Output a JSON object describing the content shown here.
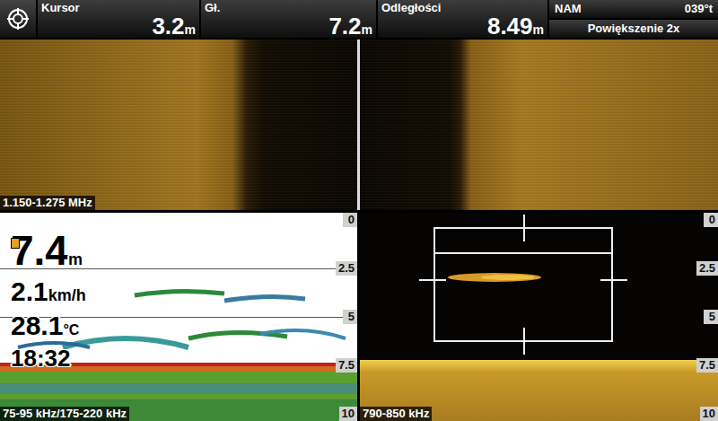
{
  "top_bar": {
    "fields": [
      {
        "label": "Kursor",
        "value": "3.2",
        "unit": "m"
      },
      {
        "label": "Gł.",
        "value": "7.2",
        "unit": "m"
      },
      {
        "label": "Odległości",
        "value": "8.49",
        "unit": "m"
      }
    ],
    "heading": {
      "label": "NAM",
      "value": "039°t"
    },
    "zoom": "Powiększenie 2x"
  },
  "side_imaging": {
    "frequency": "1.150-1.275 MHz"
  },
  "sonar_2d": {
    "readings": {
      "depth": {
        "value": "7.4",
        "unit": "m"
      },
      "speed": {
        "value": "2.1",
        "unit": "km/h"
      },
      "temperature": {
        "value": "28.1",
        "unit": "°C"
      },
      "time": "18:32"
    },
    "scale": [
      "0",
      "2.5",
      "5",
      "7.5",
      "10"
    ],
    "frequency": "75-95 kHz/175-220 kHz"
  },
  "down_imaging": {
    "scale": [
      "0",
      "2.5",
      "5",
      "7.5",
      "10"
    ],
    "frequency": "790-850 kHz"
  }
}
